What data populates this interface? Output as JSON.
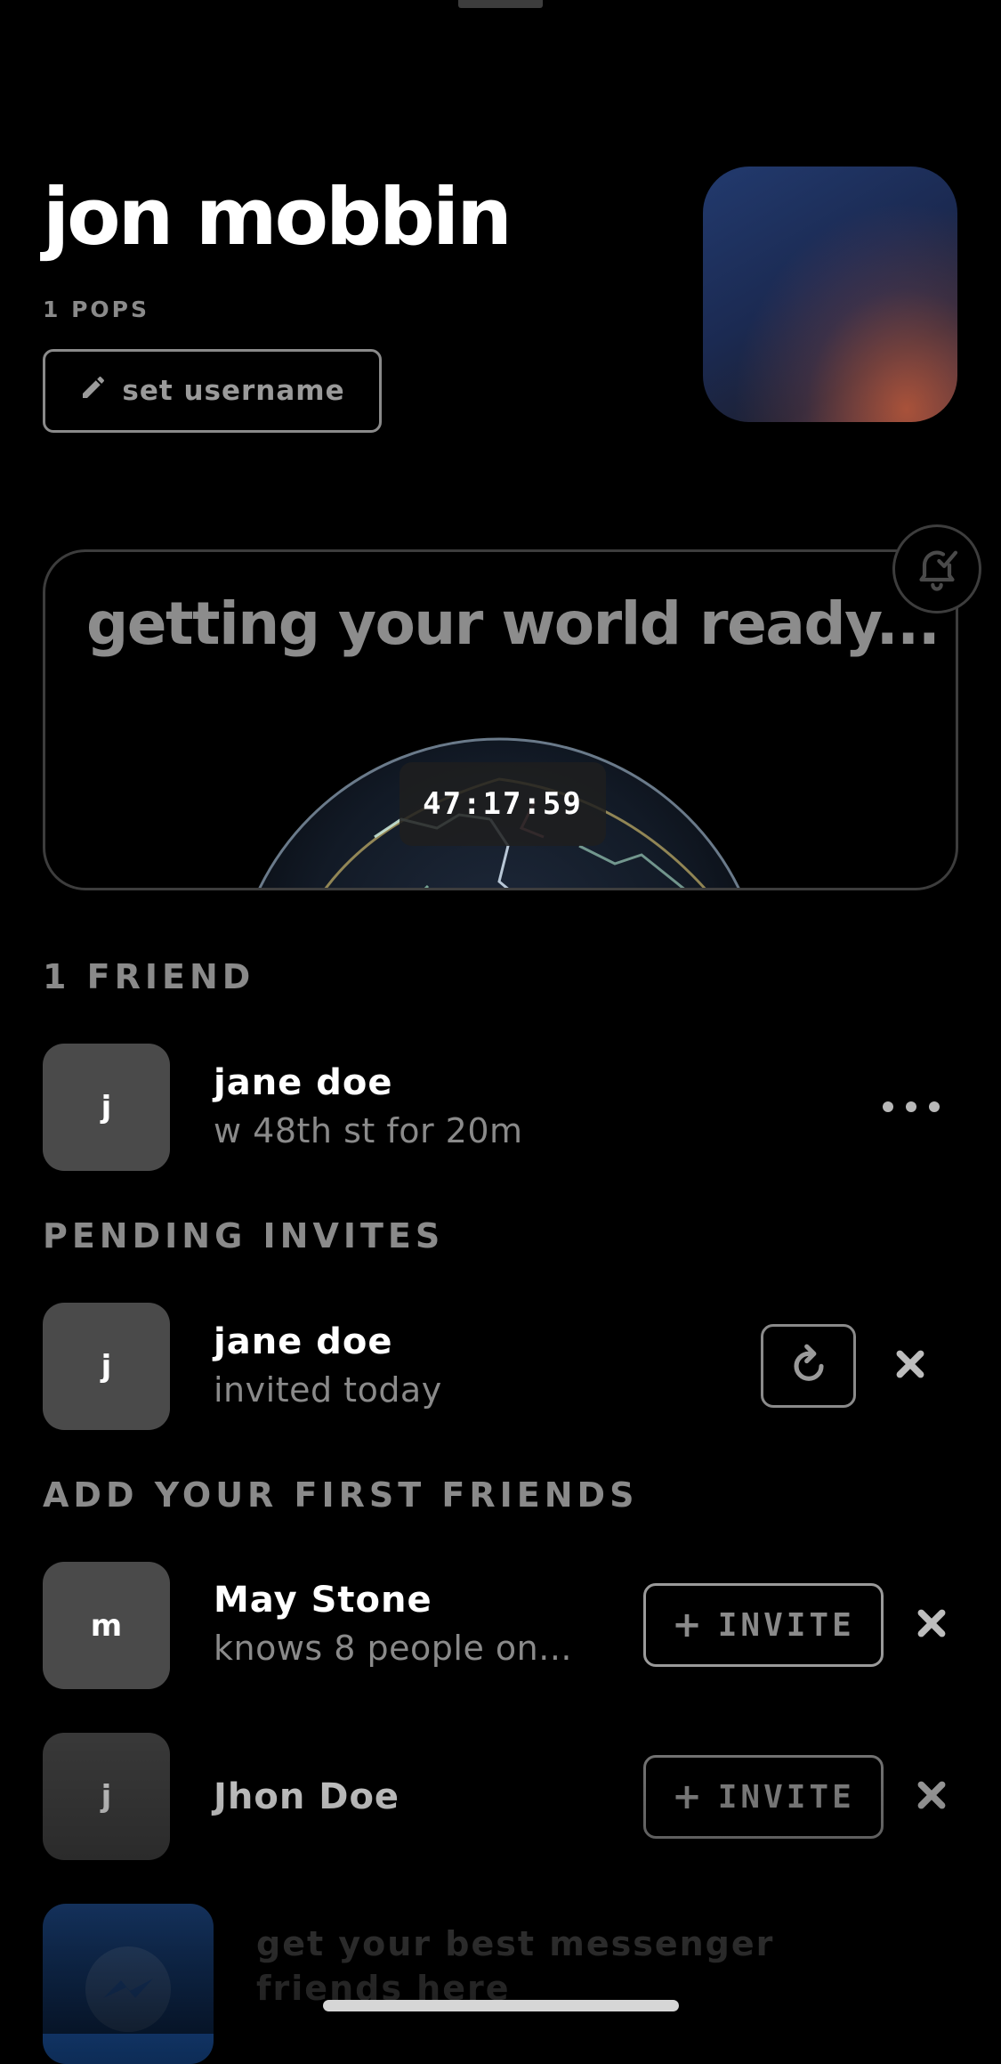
{
  "profile": {
    "name": "jon mobbin",
    "pops": "1 POPS",
    "set_username_label": "set username"
  },
  "world_card": {
    "title": "getting your world ready...",
    "timer": "47:17:59"
  },
  "friends_section": {
    "label": "1 FRIEND",
    "items": [
      {
        "initial": "j",
        "name": "jane doe",
        "subtitle": "w 48th st for 20m"
      }
    ]
  },
  "pending_section": {
    "label": "PENDING INVITES",
    "items": [
      {
        "initial": "j",
        "name": "jane doe",
        "subtitle": "invited today"
      }
    ]
  },
  "suggestions_section": {
    "label": "ADD YOUR FIRST FRIENDS",
    "items": [
      {
        "initial": "m",
        "name": "May Stone",
        "subtitle": "knows 8 people on...",
        "invite_label": "INVITE"
      },
      {
        "initial": "j",
        "name": "Jhon Doe",
        "subtitle": "",
        "invite_label": "INVITE"
      }
    ]
  },
  "messenger_promo": {
    "text": "get your best messenger friends here"
  },
  "icons": {
    "set_username": "pencil-icon",
    "bell": "bell-check-icon",
    "more": "more-horizontal-icon",
    "resend": "refresh-icon",
    "dismiss": "close-icon",
    "invite": "plus-icon",
    "messenger": "messenger-icon"
  },
  "colors": {
    "background": "#000000",
    "muted_text": "#8a8a8a",
    "avatar_tile": "#4a4a4a",
    "messenger_blue": "#1e4a8a"
  }
}
